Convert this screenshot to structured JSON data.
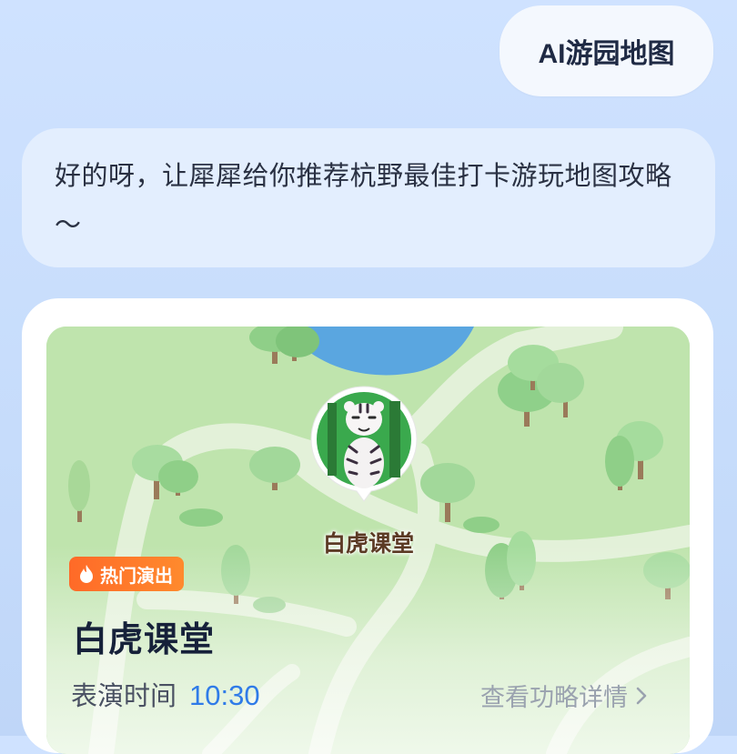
{
  "chat": {
    "user_message": "AI游园地图",
    "bot_message": "好的呀，让犀犀给你推荐杭野最佳打卡游玩地图攻略～"
  },
  "map": {
    "marker_label": "白虎课堂",
    "marker_icon": "tiger-icon"
  },
  "show": {
    "badge_icon": "fire-icon",
    "badge_label": "热门演出",
    "title": "白虎课堂",
    "time_label": "表演时间",
    "time_value": "10:30",
    "detail_link": "查看功略详情",
    "detail_icon": "chevron-right-icon"
  },
  "colors": {
    "accent_blue": "#2f7be8",
    "badge_orange": "#ff6a28",
    "map_grass": "#b8e0a8",
    "map_water": "#5aa6e0"
  }
}
